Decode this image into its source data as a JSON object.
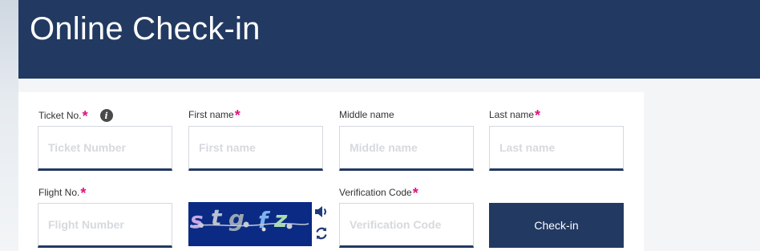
{
  "header": {
    "title": "Online Check-in"
  },
  "form": {
    "required_marker": "*",
    "ticket_no": {
      "label": "Ticket No.",
      "placeholder": "Ticket Number",
      "value": ""
    },
    "first_name": {
      "label": "First name",
      "placeholder": "First name",
      "value": ""
    },
    "middle_name": {
      "label": "Middle name",
      "placeholder": "Middle name",
      "value": ""
    },
    "last_name": {
      "label": "Last name",
      "placeholder": "Last name",
      "value": ""
    },
    "flight_no": {
      "label": "Flight No.",
      "placeholder": "Flight Number",
      "value": ""
    },
    "verification_code": {
      "label": "Verification Code",
      "placeholder": "Verification Code",
      "value": ""
    },
    "captcha_text": "stgfz",
    "submit_label": "Check-in"
  },
  "icons": {
    "info": "info-icon",
    "audio": "speaker-icon",
    "refresh": "refresh-icon"
  },
  "colors": {
    "header_bg": "#223a62",
    "accent": "#223a62",
    "required": "#e0137e",
    "captcha_bg": "#0a2a84"
  }
}
